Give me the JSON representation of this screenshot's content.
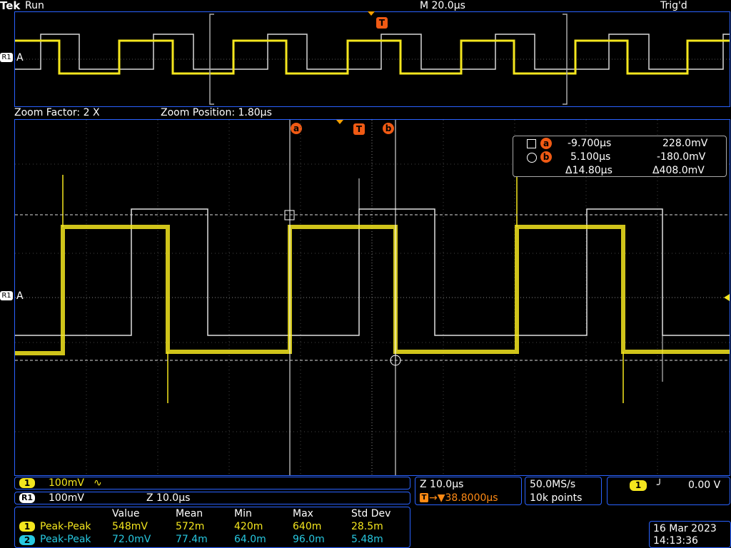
{
  "top_bar": {
    "brand": "Tek",
    "state": "Run",
    "timebase": "M 20.0µs",
    "trigger_status": "Trig'd"
  },
  "markers": {
    "trigger": "T",
    "cursor_a": "a",
    "cursor_b": "b",
    "ref": "R1",
    "channel_a": "A"
  },
  "zoom": {
    "factor": "Zoom Factor: 2 X",
    "position": "Zoom Position: 1.80µs"
  },
  "cursor_readout": {
    "a_time": "-9.700µs",
    "a_volt": "228.0mV",
    "b_time": "5.100µs",
    "b_volt": "-180.0mV",
    "delta_time": "Δ14.80µs",
    "delta_volt": "Δ408.0mV"
  },
  "channel_info": {
    "ch1_num": "1",
    "ch1_scale": "100mV",
    "ch1_coupling": "∿",
    "ref1_label": "R1",
    "ref1_scale": "100mV",
    "ref1_zoom": "Z 10.0µs"
  },
  "timebase_box": {
    "zoom": "Z 10.0µs",
    "trigger_pos_icon": "T",
    "trigger_pos": "→▼38.8000µs"
  },
  "acquisition": {
    "rate": "50.0MS/s",
    "points": "10k points"
  },
  "trigger_box": {
    "source": "1",
    "slope_icon": "rising-edge-icon",
    "slope": "╯",
    "level": "0.00 V"
  },
  "measurements": {
    "headers": [
      "Value",
      "Mean",
      "Min",
      "Max",
      "Std Dev"
    ],
    "rows": [
      {
        "ch": "1",
        "name": "Peak-Peak",
        "value": "548mV",
        "mean": "572m",
        "min": "420m",
        "max": "640m",
        "std": "28.5m"
      },
      {
        "ch": "2",
        "name": "Peak-Peak",
        "value": "72.0mV",
        "mean": "77.4m",
        "min": "64.0m",
        "max": "96.0m",
        "std": "5.48m"
      }
    ]
  },
  "datetime": {
    "date": "16 Mar 2023",
    "time": "14:13:36"
  },
  "colors": {
    "ch1": "#f4e61e",
    "ref": "#ffffff",
    "ch2": "#27c8e0",
    "accent": "#2a62ff",
    "marker": "#f05a14"
  }
}
